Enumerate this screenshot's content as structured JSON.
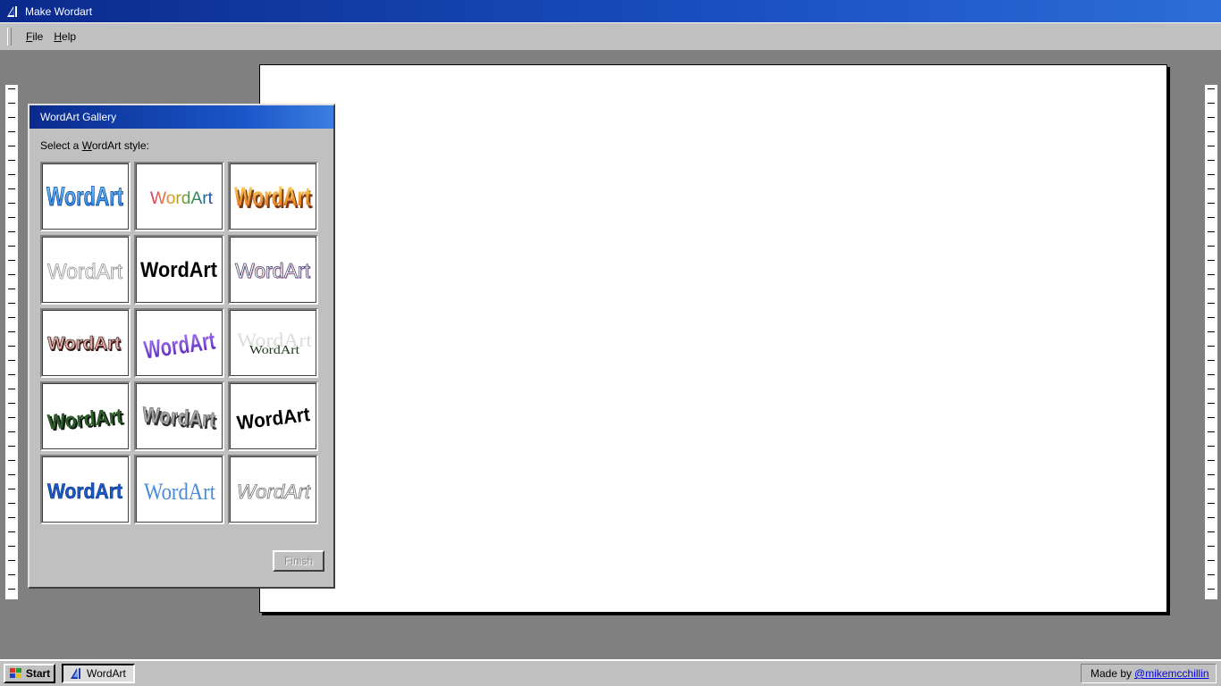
{
  "window": {
    "title": "Make Wordart"
  },
  "menu": {
    "items": [
      {
        "label": "File",
        "accel": "F",
        "rest": "ile"
      },
      {
        "label": "Help",
        "accel": "H",
        "rest": "elp"
      }
    ]
  },
  "dialog": {
    "title": "WordArt Gallery",
    "prompt_pre": "Select a ",
    "prompt_accel": "W",
    "prompt_post": "ordArt style:",
    "tile_text": "WordArt",
    "styles": [
      "blue-gradient-arch",
      "rainbow-thin",
      "orange-3d-block",
      "white-outline",
      "black-wave",
      "pink-shadow-outline",
      "brown-3d-shadow",
      "purple-gradient-slant",
      "serif-reflection",
      "green-3d-wave",
      "gray-3d-stone",
      "black-curve-up",
      "blue-bold-flat",
      "blue-serif-arch",
      "gray-italic-outline"
    ],
    "finish_label": "Finish"
  },
  "taskbar": {
    "start_label": "Start",
    "task_label": "WordArt",
    "credit_prefix": "Made by",
    "credit_link": "@mikemcchillin"
  },
  "colors": {
    "titlebar_start": "#0a2a8c",
    "titlebar_end": "#2c6ed8",
    "face": "#c0c0c0",
    "desktop": "#808080"
  }
}
